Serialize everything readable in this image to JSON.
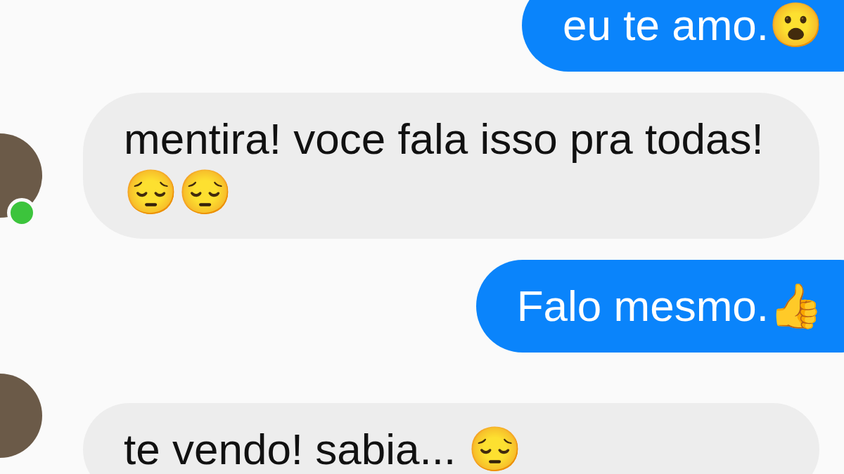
{
  "messages": [
    {
      "kind": "outgoing",
      "text": "eu te amo.😮"
    },
    {
      "kind": "incoming",
      "text": "mentira! voce fala isso pra todas! 😔😔",
      "online": true
    },
    {
      "kind": "outgoing",
      "text": "Falo mesmo.👍"
    },
    {
      "kind": "incoming",
      "text": "te vendo! sabia... 😔",
      "online": false
    }
  ]
}
